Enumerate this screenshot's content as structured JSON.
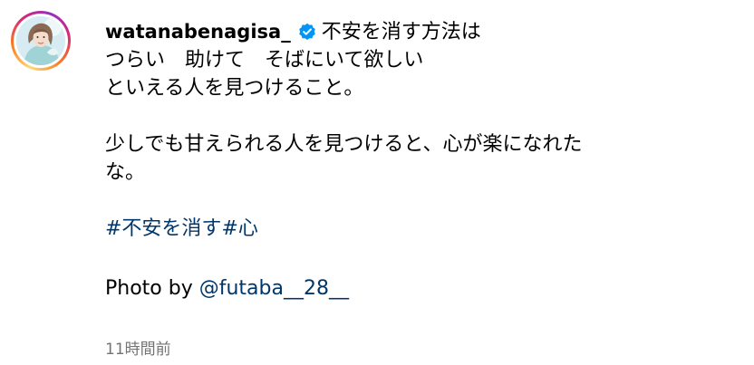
{
  "post": {
    "username": "watanabenagisa_",
    "caption_first_line": "不安を消す方法は",
    "caption_lines": [
      "つらい　助けて　そばにいて欲しい",
      "といえる人を見つけること。"
    ],
    "caption_paragraph2_lines": [
      "少しでも甘えられる人を見つけると、心が楽になれた",
      "な。"
    ],
    "hashtags": [
      "#不安を消す",
      "#心"
    ],
    "photo_credit_prefix": "Photo by ",
    "photo_credit_mention": "@futaba__28__",
    "timestamp": "11時間前"
  },
  "colors": {
    "link": "#00376b",
    "verified": "#0095f6",
    "muted": "#737373"
  },
  "icons": {
    "verified": "verified-badge-icon"
  }
}
